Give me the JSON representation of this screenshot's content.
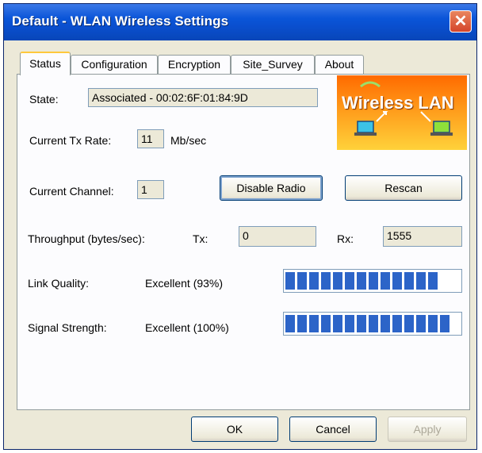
{
  "window": {
    "title": "Default - WLAN Wireless Settings"
  },
  "tabs": [
    {
      "label": "Status"
    },
    {
      "label": "Configuration"
    },
    {
      "label": "Encryption"
    },
    {
      "label": "Site_Survey"
    },
    {
      "label": "About"
    }
  ],
  "status": {
    "state_label": "State:",
    "state_value": "Associated - 00:02:6F:01:84:9D",
    "tx_rate_label": "Current Tx Rate:",
    "tx_rate_value": "11",
    "tx_rate_unit": "Mb/sec",
    "channel_label": "Current Channel:",
    "channel_value": "1",
    "throughput_label": "Throughput (bytes/sec):",
    "tx_label": "Tx:",
    "tx_value": "0",
    "rx_label": "Rx:",
    "rx_value": "1555",
    "link_quality_label": "Link Quality:",
    "link_quality_value": "Excellent (93%)",
    "link_quality_percent": 93,
    "signal_strength_label": "Signal Strength:",
    "signal_strength_value": "Excellent (100%)",
    "signal_strength_percent": 100
  },
  "logo": {
    "text": "Wireless LAN"
  },
  "buttons": {
    "disable_radio": "Disable Radio",
    "rescan": "Rescan",
    "ok": "OK",
    "cancel": "Cancel",
    "apply": "Apply"
  },
  "colors": {
    "titlebar": "#0a55d8",
    "progress": "#2c64c8",
    "tab_highlight": "#ffc83c"
  }
}
